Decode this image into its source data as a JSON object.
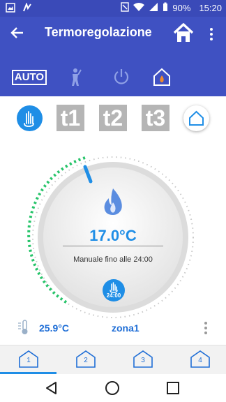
{
  "statusbar": {
    "battery": "90%",
    "time": "15:20"
  },
  "appbar": {
    "title": "Termoregolazione"
  },
  "modes": {
    "auto_label": "AUTO"
  },
  "programs": [
    "t1",
    "t2",
    "t3"
  ],
  "thermostat": {
    "setpoint": "17.0°C",
    "mode_text": "Manuale fino alle 24:00",
    "badge_time": "24:00"
  },
  "info": {
    "measured_temp": "25.9°C",
    "zone": "zona1"
  },
  "zones": [
    {
      "label": "1"
    },
    {
      "label": "2"
    },
    {
      "label": "3"
    },
    {
      "label": "4"
    }
  ],
  "colors": {
    "primary": "#3f51c2",
    "accent": "#1f8ee6",
    "green_arc": "#27c46a",
    "flame": "#5b8de0"
  }
}
